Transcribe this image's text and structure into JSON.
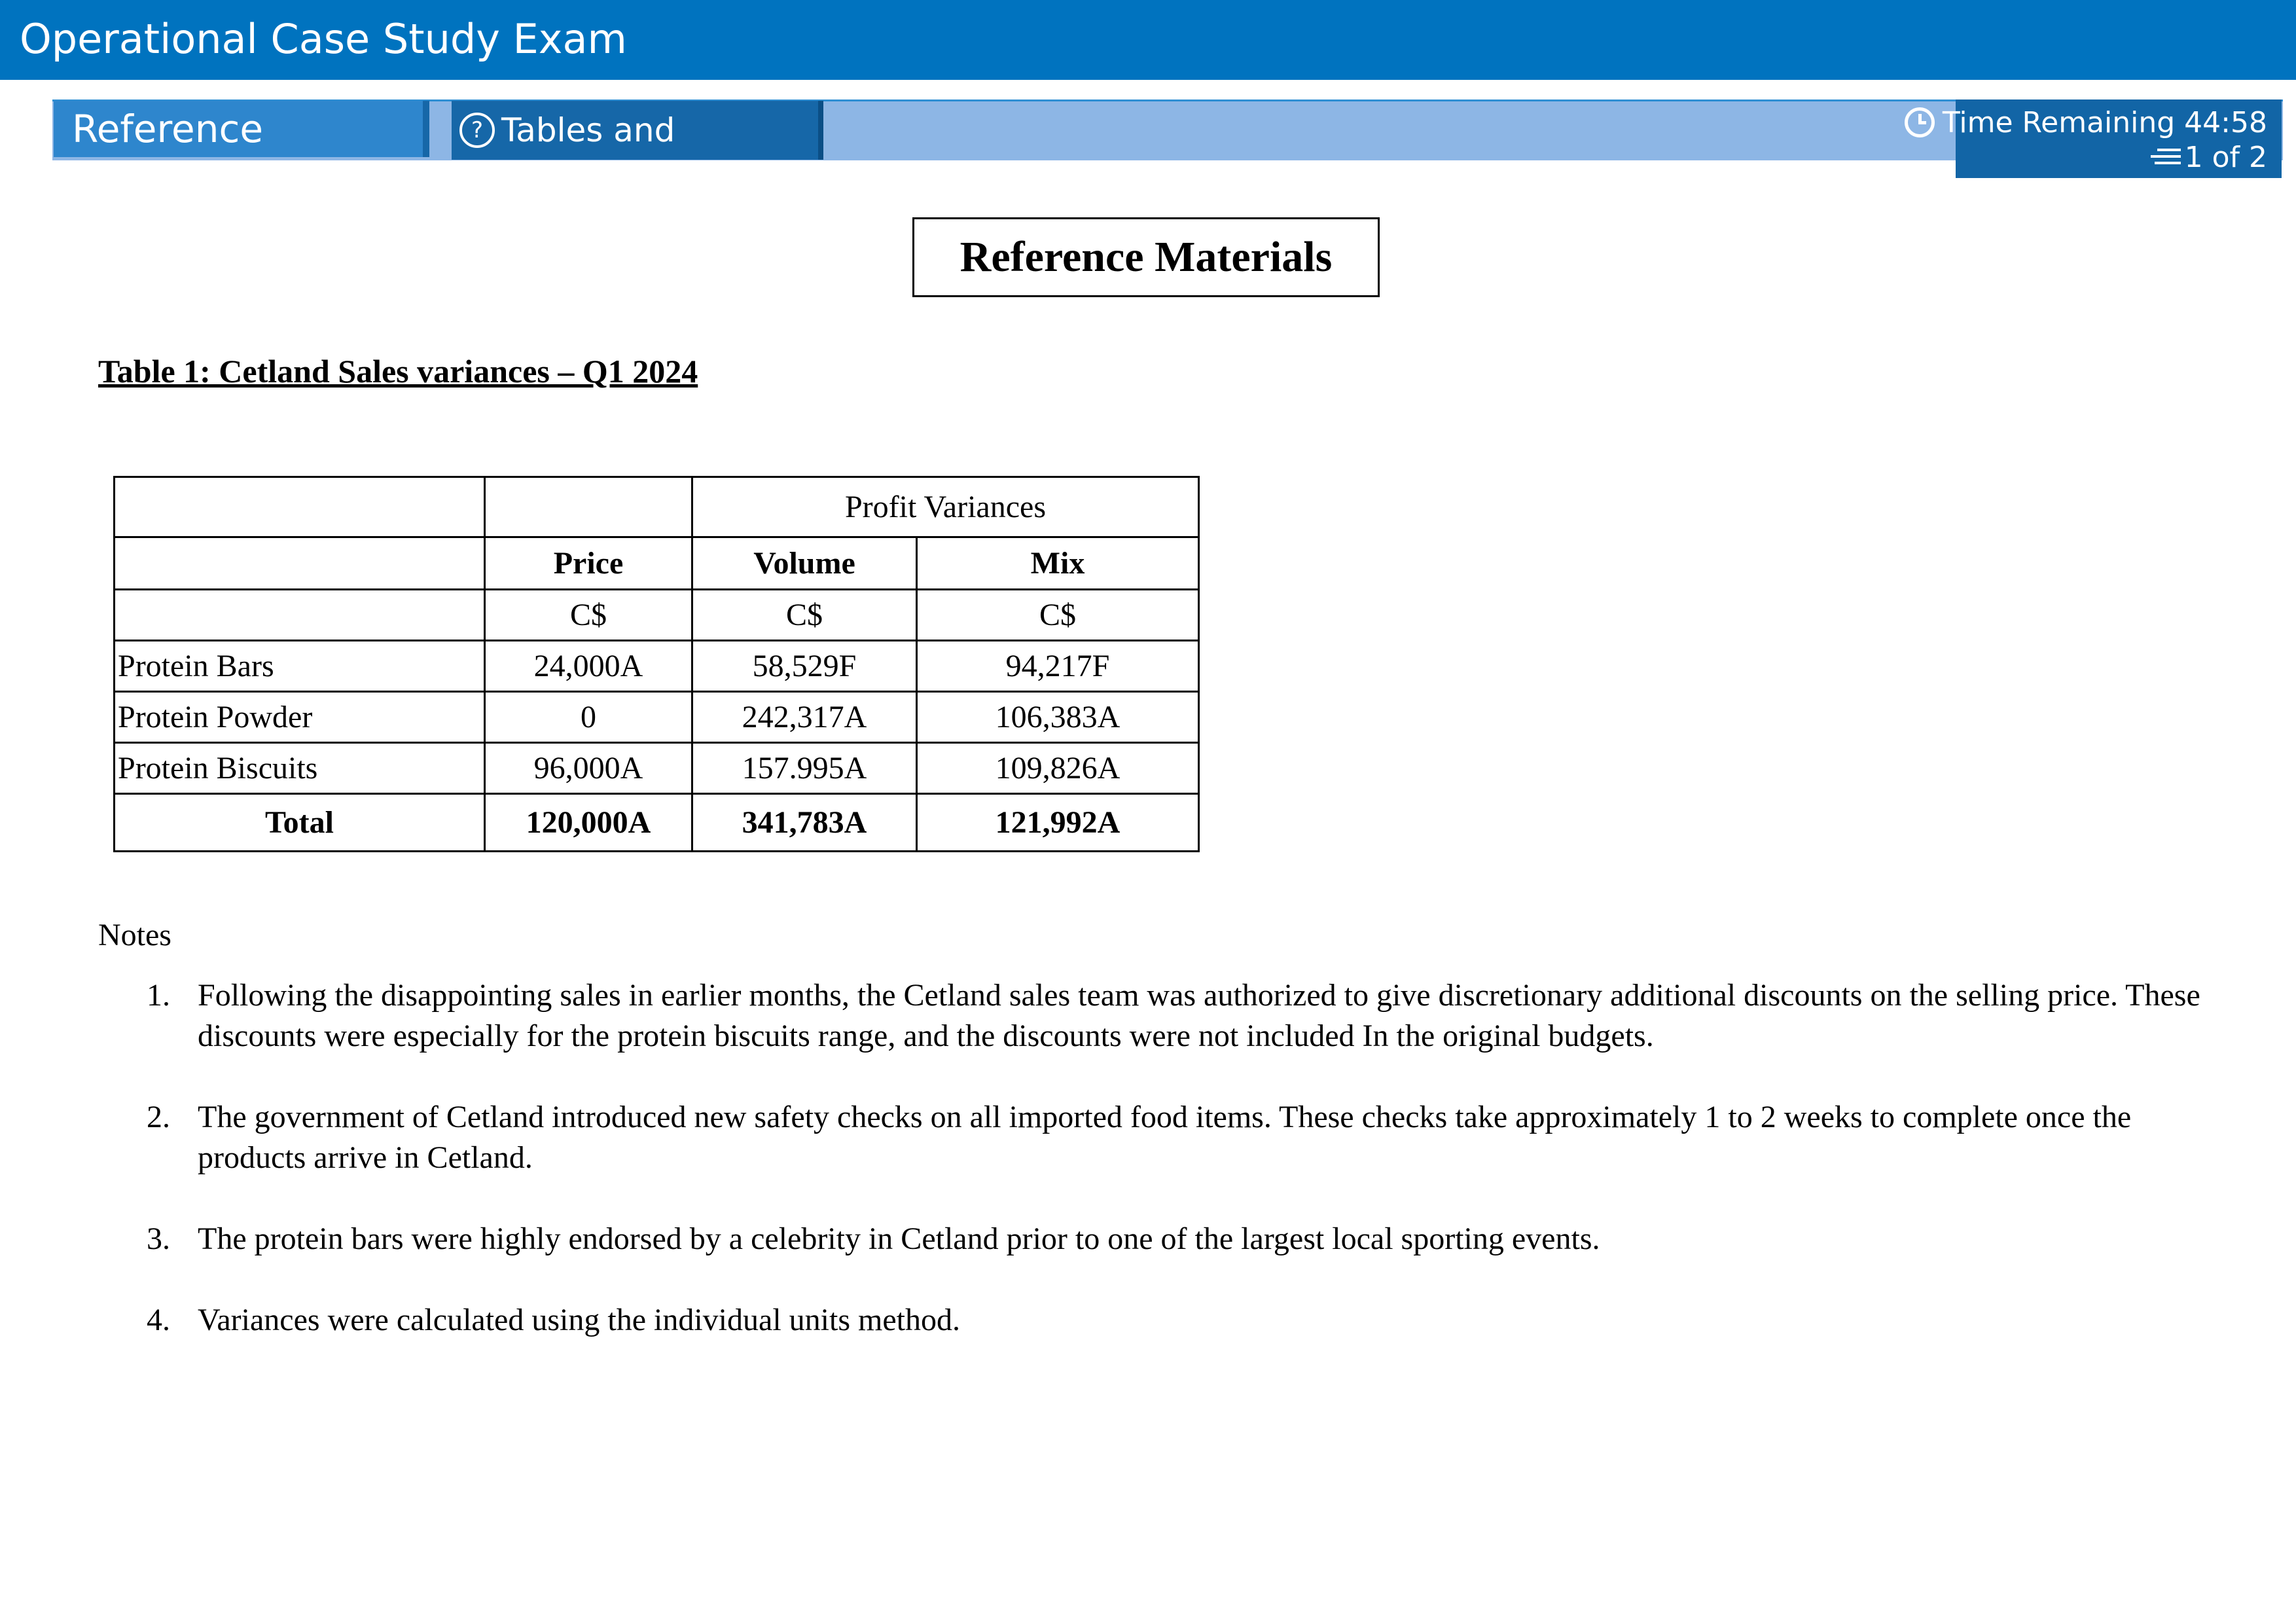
{
  "window": {
    "title": "Operational Case Study Exam"
  },
  "toolbar": {
    "reference_tab": "Reference Material",
    "tables_tab": "Tables and Formulae",
    "timer": "Time Remaining 44:58",
    "page_indicator": "1 of 2"
  },
  "doc": {
    "heading": "Reference Materials",
    "table_title": "Table 1: Cetland Sales variances – Q1 2024",
    "table": {
      "group_header": "Profit Variances",
      "columns": [
        "Price",
        "Volume",
        "Mix"
      ],
      "currency": [
        "C$",
        "C$",
        "C$"
      ],
      "rows": [
        {
          "label": "Protein Bars",
          "values": [
            "24,000A",
            "58,529F",
            "94,217F"
          ]
        },
        {
          "label": "Protein Powder",
          "values": [
            "0",
            "242,317A",
            "106,383A"
          ]
        },
        {
          "label": "Protein Biscuits",
          "values": [
            "96,000A",
            "157.995A",
            "109,826A"
          ]
        }
      ],
      "total": {
        "label": "Total",
        "values": [
          "120,000A",
          "341,783A",
          "121,992A"
        ]
      }
    },
    "notes_label": "Notes",
    "notes": [
      {
        "num": "1.",
        "text": "Following the disappointing sales in earlier months, the Cetland sales team was authorized to give discretionary additional discounts on the selling price. These discounts were especially for the protein biscuits range, and the discounts were not included In the original budgets."
      },
      {
        "num": "2.",
        "text": "The government of Cetland introduced new safety checks on all imported food items. These checks take approximately 1 to 2 weeks to complete once the products arrive in Cetland."
      },
      {
        "num": "3.",
        "text": "The protein bars were highly endorsed by a celebrity in Cetland prior to one of the largest local sporting events."
      },
      {
        "num": "4.",
        "text": "Variances were calculated using the individual units method."
      }
    ]
  },
  "colors": {
    "titlebar": "#0073bf",
    "toolbar": "#8db6e5",
    "active_tab": "#2e86cd",
    "timer_bg": "#1265a6"
  },
  "icons": {
    "help": "question-circle-icon",
    "clock": "clock-icon",
    "pages": "pages-icon"
  }
}
